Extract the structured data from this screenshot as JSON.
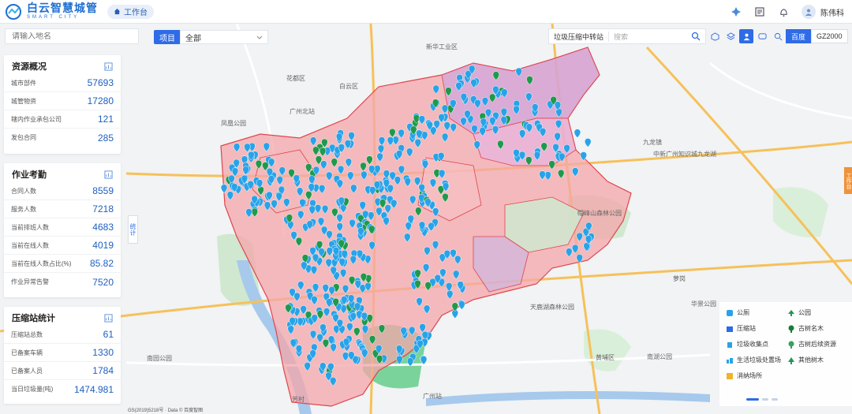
{
  "app": {
    "title_cn": "白云智慧城管",
    "title_en": "SMART CITY",
    "workbench": "工作台",
    "user": "陈伟科"
  },
  "search": {
    "placeholder": "请输入地名"
  },
  "filter": {
    "project_label": "项目",
    "project_value": "全部"
  },
  "map_tools": {
    "category": "垃圾压缩中转站",
    "search_placeholder": "搜索",
    "map_types": [
      "百度",
      "GZ2000"
    ],
    "selected_map_type": "百度"
  },
  "panels": {
    "resources": {
      "title": "资源概况",
      "rows": [
        {
          "label": "城市部件",
          "value": "57693"
        },
        {
          "label": "城管物资",
          "value": "17280"
        },
        {
          "label": "辖内作业承包公司",
          "value": "121"
        },
        {
          "label": "发包合同",
          "value": "285"
        }
      ]
    },
    "attendance": {
      "title": "作业考勤",
      "rows": [
        {
          "label": "合同人数",
          "value": "8559"
        },
        {
          "label": "服务人数",
          "value": "7218"
        },
        {
          "label": "当前排班人数",
          "value": "4683"
        },
        {
          "label": "当前在线人数",
          "value": "4019"
        },
        {
          "label": "当前在线人数占比(%)",
          "value": "85.82"
        },
        {
          "label": "作业异常告警",
          "value": "7520"
        }
      ]
    },
    "compression": {
      "title": "压缩站统计",
      "rows": [
        {
          "label": "压缩站总数",
          "value": "61"
        },
        {
          "label": "已备案车辆",
          "value": "1330"
        },
        {
          "label": "已备案人员",
          "value": "1784"
        },
        {
          "label": "当日垃圾量(吨)",
          "value": "1474.981"
        }
      ]
    }
  },
  "side_tabs": {
    "left": "统计",
    "right": "工作台"
  },
  "legend": [
    {
      "label": "公厕",
      "icon": "toilet-icon"
    },
    {
      "label": "公园",
      "icon": "park-icon"
    },
    {
      "label": "压缩站",
      "icon": "compression-station-icon"
    },
    {
      "label": "古树名木",
      "icon": "ancient-tree-icon"
    },
    {
      "label": "垃圾收集点",
      "icon": "garbage-collection-icon"
    },
    {
      "label": "古树后续资源",
      "icon": "tree-resource-icon"
    },
    {
      "label": "生活垃圾处置场",
      "icon": "disposal-site-icon"
    },
    {
      "label": "其他树木",
      "icon": "other-tree-icon"
    },
    {
      "label": "消纳场所",
      "icon": "dump-site-icon"
    }
  ],
  "map_labels": [
    "花都区",
    "白云区",
    "广州北站",
    "新华工业区",
    "凤凰公园",
    "帽峰山森林公园",
    "天鹿湖森林公园",
    "广州站",
    "南园公园",
    "黄埔区",
    "华景公园",
    "芳村",
    "萝岗",
    "九龙镇",
    "南湖公园",
    "中新广州知识城九龙湖"
  ],
  "copyright": "GS(2019)5218号 · Data © 百度智图",
  "colors": {
    "accent": "#2e6be6",
    "marker_blue": "#29a3e8",
    "marker_green": "#1f9a4d",
    "region_fill": "#f4a6aa",
    "region_border": "#e0454f"
  }
}
